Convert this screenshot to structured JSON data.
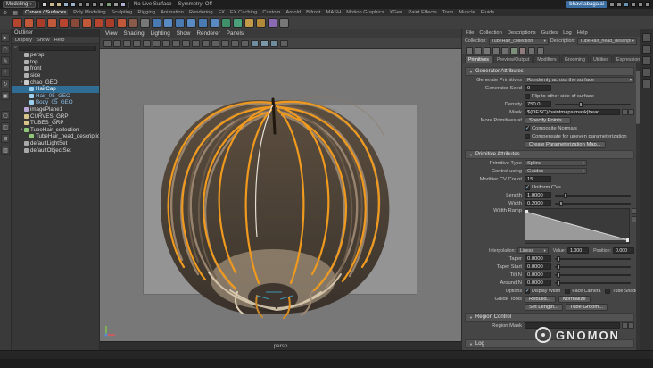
{
  "colors": {
    "accent_orange": "#e8901c",
    "guide_orange": "#f09a25",
    "selection_teal": "#2f6d94"
  },
  "topbar": {
    "workspace": "Modeling",
    "live_surface": "No Live Surface",
    "symmetry": "Symmetry: Off",
    "username_overlay": "bhavitabagaiai",
    "left_icons": [
      {
        "name": "scene-new-icon",
        "color": "#d0d0d0"
      },
      {
        "name": "scene-open-icon",
        "color": "#c8b890"
      },
      {
        "name": "scene-save-icon",
        "color": "#c8b890"
      },
      {
        "name": "undo-icon",
        "color": "#9ab0c8"
      },
      {
        "name": "redo-icon",
        "color": "#9ab0c8"
      },
      {
        "name": "snap-grid-icon",
        "color": "#888888"
      },
      {
        "name": "snap-curve-icon",
        "color": "#888888"
      },
      {
        "name": "snap-point-icon",
        "color": "#888888"
      },
      {
        "name": "snap-projected-center-icon",
        "color": "#888888"
      },
      {
        "name": "make-live-icon",
        "color": "#7a9a7a"
      },
      {
        "name": "construction-history-icon",
        "color": "#9a9a9a"
      },
      {
        "name": "render-current-frame-icon",
        "color": "#b0b0d0"
      }
    ],
    "right_icons": [
      {
        "name": "sidebar-attribute-editor-icon",
        "color": "#8a8a8a"
      },
      {
        "name": "sidebar-tool-settings-icon",
        "color": "#8a8a8a"
      },
      {
        "name": "sidebar-channel-box-icon",
        "color": "#6a94b4"
      },
      {
        "name": "workspace-docking-icon",
        "color": "#8a8a8a"
      },
      {
        "name": "render-view-icon",
        "color": "#8a8a8a"
      },
      {
        "name": "hypershade-icon",
        "color": "#8a8a8a"
      }
    ]
  },
  "shelf": {
    "tabs": [
      {
        "label": "Curves / Surfaces",
        "cls": "active"
      },
      {
        "label": "Poly Modeling"
      },
      {
        "label": "Sculpting"
      },
      {
        "label": "Rigging"
      },
      {
        "label": "Animation"
      },
      {
        "label": "Rendering"
      },
      {
        "label": "FX"
      },
      {
        "label": "FX Caching"
      },
      {
        "label": "Custom"
      },
      {
        "label": "Arnold"
      },
      {
        "label": "Bifrost"
      },
      {
        "label": "MASH"
      },
      {
        "label": "Motion Graphics"
      },
      {
        "label": "XGen"
      },
      {
        "label": "Paint Effects"
      },
      {
        "label": "Toon"
      },
      {
        "label": "Muscle"
      },
      {
        "label": "Fluids"
      }
    ],
    "icons": [
      {
        "name": "cv-curve-tool-icon",
        "color": "#b5452e"
      },
      {
        "name": "ep-curve-tool-icon",
        "color": "#c2583a"
      },
      {
        "name": "bezier-curve-tool-icon",
        "color": "#a83d2a"
      },
      {
        "name": "pencil-curve-tool-icon",
        "color": "#c2583a"
      },
      {
        "name": "arc-tool-icon",
        "color": "#b5452e"
      },
      {
        "name": "attach-curves-icon",
        "color": "#8a4a3a"
      },
      {
        "name": "detach-curves-icon",
        "color": "#c2583a"
      },
      {
        "name": "insert-knot-icon",
        "color": "#b5452e"
      },
      {
        "name": "extend-curve-icon",
        "color": "#a83d2a"
      },
      {
        "name": "offset-curve-icon",
        "color": "#c2583a"
      },
      {
        "name": "rebuild-curve-icon",
        "color": "#8a5a4a"
      },
      {
        "name": "reverse-curve-icon",
        "color": "#777777"
      },
      {
        "name": "nurbs-sphere-icon",
        "color": "#4a7ab2"
      },
      {
        "name": "nurbs-cube-icon",
        "color": "#5a8ac2"
      },
      {
        "name": "nurbs-cylinder-icon",
        "color": "#4a7ab2"
      },
      {
        "name": "nurbs-cone-icon",
        "color": "#5a8ac2"
      },
      {
        "name": "nurbs-plane-icon",
        "color": "#4a7ab2"
      },
      {
        "name": "nurbs-torus-icon",
        "color": "#5a8ac2"
      },
      {
        "name": "revolve-icon",
        "color": "#3f8f6a"
      },
      {
        "name": "loft-icon",
        "color": "#4aa07a"
      },
      {
        "name": "planar-icon",
        "color": "#c29a4a"
      },
      {
        "name": "extrude-icon",
        "color": "#b28a3a"
      },
      {
        "name": "birail-icon",
        "color": "#8a6ab2"
      },
      {
        "name": "boundary-icon",
        "color": "#777777"
      }
    ]
  },
  "toolbox": {
    "tools": [
      {
        "name": "select-tool-icon",
        "glyph": "▶"
      },
      {
        "name": "lasso-tool-icon",
        "glyph": "◠"
      },
      {
        "name": "paint-select-tool-icon",
        "glyph": "✎"
      },
      {
        "name": "move-tool-icon",
        "glyph": "+"
      },
      {
        "name": "rotate-tool-icon",
        "glyph": "↻"
      },
      {
        "name": "scale-tool-icon",
        "glyph": "▣"
      }
    ],
    "layouts": [
      {
        "name": "layout-single-pane-icon",
        "glyph": "▢"
      },
      {
        "name": "layout-two-pane-icon",
        "glyph": "◫"
      },
      {
        "name": "layout-four-pane-icon",
        "glyph": "⊞"
      },
      {
        "name": "layout-outliner-pane-icon",
        "glyph": "▥"
      }
    ]
  },
  "outliner": {
    "title": "Outliner",
    "menus": [
      "Display",
      "Show",
      "Help"
    ],
    "items": [
      {
        "label": "persp",
        "indent": 1,
        "icon": "#b0b0b0",
        "tw": ""
      },
      {
        "label": "top",
        "indent": 1,
        "icon": "#b0b0b0",
        "tw": ""
      },
      {
        "label": "front",
        "indent": 1,
        "icon": "#b0b0b0",
        "tw": ""
      },
      {
        "label": "side",
        "indent": 1,
        "icon": "#b0b0b0",
        "tw": ""
      },
      {
        "label": "chao_GEO",
        "indent": 1,
        "icon": "#cccccc",
        "tw": "▾"
      },
      {
        "label": "HairCap",
        "indent": 2,
        "icon": "#9ad0f0",
        "tw": "",
        "cls": "sel"
      },
      {
        "label": "Hair_05_GEO",
        "indent": 2,
        "icon": "#9ad0f0",
        "tw": "",
        "cls": "blue"
      },
      {
        "label": "Body_05_GEO",
        "indent": 2,
        "icon": "#9ad0f0",
        "tw": "",
        "cls": "blue"
      },
      {
        "label": "imagePlane1",
        "indent": 1,
        "icon": "#b9a8d8",
        "tw": ""
      },
      {
        "label": "CURVES_GRP",
        "indent": 1,
        "icon": "#d8c48a",
        "tw": ""
      },
      {
        "label": "TUBES_GRP",
        "indent": 1,
        "icon": "#d8c48a",
        "tw": ""
      },
      {
        "label": "TubeHair_collection",
        "indent": 1,
        "icon": "#8ec878",
        "tw": "▾"
      },
      {
        "label": "TubeHair_head_description",
        "indent": 2,
        "icon": "#8ec878",
        "tw": ""
      },
      {
        "label": "defaultLightSet",
        "indent": 1,
        "icon": "#a8a8a8",
        "tw": ""
      },
      {
        "label": "defaultObjectSet",
        "indent": 1,
        "icon": "#a8a8a8",
        "tw": ""
      }
    ]
  },
  "viewport": {
    "menus": [
      "View",
      "Shading",
      "Lighting",
      "Show",
      "Renderer",
      "Panels"
    ],
    "camera_label": "persp",
    "toolbar_icons": [
      {
        "name": "select-camera-icon",
        "color": "#606060"
      },
      {
        "name": "lock-camera-icon",
        "color": "#606060"
      },
      {
        "name": "camera-attributes-icon",
        "color": "#606060"
      },
      {
        "name": "bookmark-icon",
        "color": "#606060"
      },
      {
        "name": "image-plane-icon",
        "color": "#606060"
      },
      {
        "name": "2d-pan-zoom-icon",
        "color": "#606060"
      },
      {
        "name": "grease-pencil-icon",
        "color": "#606060"
      },
      {
        "name": "grid-toggle-icon",
        "color": "#606060"
      },
      {
        "name": "film-gate-icon",
        "color": "#606060"
      },
      {
        "name": "resolution-gate-icon",
        "color": "#606060"
      },
      {
        "name": "gate-mask-icon",
        "color": "#606060"
      },
      {
        "name": "field-chart-icon",
        "color": "#606060"
      },
      {
        "name": "safe-action-icon",
        "color": "#606060"
      },
      {
        "name": "safe-title-icon",
        "color": "#606060"
      },
      {
        "name": "frame-all-icon",
        "color": "#606060"
      },
      {
        "name": "wireframe-mode-icon",
        "color": "#6f8d9e"
      },
      {
        "name": "shaded-mode-icon",
        "color": "#7b98a8"
      },
      {
        "name": "textured-mode-icon",
        "color": "#6f8d9e"
      },
      {
        "name": "lit-mode-icon",
        "color": "#606060"
      }
    ]
  },
  "xgen": {
    "menus": [
      "File",
      "Collection",
      "Descriptions",
      "Guides",
      "Log",
      "Help"
    ],
    "collection_label": "Collection:",
    "collection_value": "TubeHair_collection",
    "description_label": "Description:",
    "description_value": "TubeHair_head_description",
    "toolbar_icons": [
      {
        "name": "import-collection-icon",
        "color": "#6f6f6f"
      },
      {
        "name": "export-collection-icon",
        "color": "#6f6f6f"
      },
      {
        "name": "create-description-icon",
        "color": "#767676"
      },
      {
        "name": "duplicate-description-icon",
        "color": "#6f6f6f"
      },
      {
        "name": "delete-description-icon",
        "color": "#6f6f6f"
      },
      {
        "name": "refresh-preview-icon",
        "color": "#7b8f7b"
      },
      {
        "name": "clear-preview-icon",
        "color": "#8f7b7b"
      },
      {
        "name": "guides-toggle-icon",
        "color": "#6f6f6f"
      },
      {
        "name": "sculpt-guides-icon",
        "color": "#6f6f6f"
      }
    ],
    "tabs": [
      {
        "label": "Primitives",
        "cls": "active"
      },
      {
        "label": "Preview/Output"
      },
      {
        "label": "Modifiers"
      },
      {
        "label": "Grooming"
      },
      {
        "label": "Utilities"
      },
      {
        "label": "Expressions"
      }
    ],
    "generator": {
      "title": "Generator Attributes",
      "generate_primitives_label": "Generate Primitives",
      "generate_primitives_value": "Randomly across the surface",
      "seed_label": "Generator Seed",
      "seed_value": "0",
      "flip_label": "Flip to other side of surface",
      "flip_checked": false,
      "density_label": "Density",
      "density_value": "750.0",
      "mask_label": "Mask",
      "mask_value": "$(DESC)/paintmaps/mask|head",
      "more_label": "More Primitives at",
      "more_button": "Specify Points...",
      "composite_label": "Composite Normals",
      "composite_checked": true,
      "compensate_label": "Compensate for uneven parameterization",
      "compensate_checked": false,
      "param_map_button": "Create Parameterization Map..."
    },
    "primitive": {
      "title": "Primitive Attributes",
      "type_label": "Primitive Type",
      "type_value": "Spline",
      "control_label": "Control using",
      "control_value": "Guides",
      "cv_label": "Modifier CV Count",
      "cv_value": "15",
      "uniform_label": "Uniform CVs",
      "uniform_checked": true,
      "length_label": "Length",
      "length_value": "1.0000",
      "width_label": "Width",
      "width_value": "0.2000",
      "ramp_label": "Width Ramp",
      "interp_label": "Interpolation:",
      "interp_value": "Linear",
      "value_label": "Value:",
      "value_value": "1.000",
      "position_label": "Position:",
      "position_value": "0.000",
      "taper_label": "Taper",
      "taper_value": "0.0000",
      "taper_start_label": "Taper Start",
      "taper_start_value": "0.0000",
      "tilt_label": "Tilt N",
      "tilt_value": "0.0000",
      "around_label": "Around N",
      "around_value": "0.0000",
      "options_label": "Options",
      "opt_display_width": "Display Width",
      "display_width_checked": true,
      "opt_face_camera": "Face Camera",
      "face_camera_checked": false,
      "opt_tube_shade": "Tube Shade",
      "tube_shade_checked": false,
      "guide_tools_label": "Guide Tools",
      "btn_rebuild": "Rebuild...",
      "btn_normalize": "Normalize",
      "btn_set_length": "Set Length...",
      "btn_tube_groom": "Tube Groom..."
    },
    "region": {
      "title": "Region Control",
      "mask_label": "Region Mask"
    },
    "log_title": "Log"
  },
  "rightstrip": {
    "icons": [
      {
        "name": "attribute-editor-tab-icon",
        "color": "#555555"
      },
      {
        "name": "tool-settings-tab-icon",
        "color": "#555555"
      },
      {
        "name": "channel-box-tab-icon",
        "color": "#555555"
      },
      {
        "name": "modeling-toolkit-tab-icon",
        "color": "#555555"
      },
      {
        "name": "xgen-tab-icon",
        "color": "#555555"
      }
    ]
  },
  "watermark": {
    "text": "GNOMON"
  }
}
